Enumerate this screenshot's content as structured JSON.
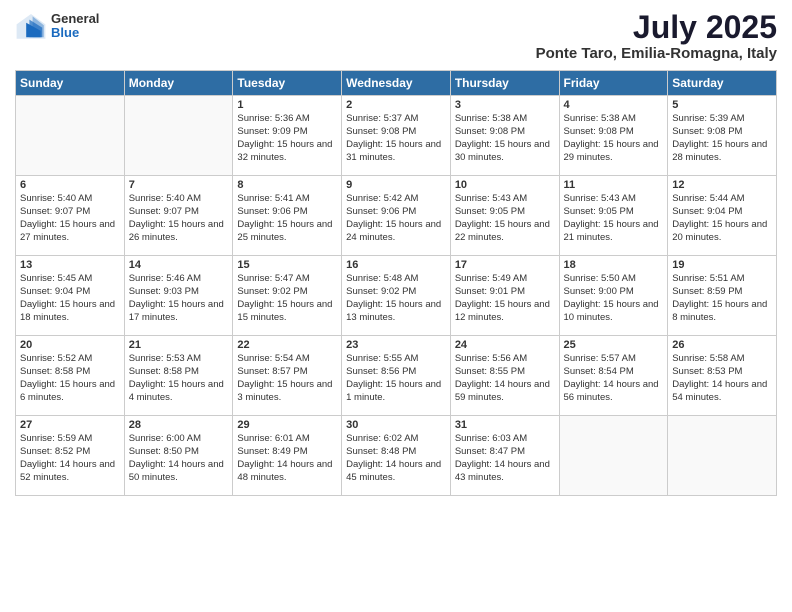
{
  "header": {
    "logo_general": "General",
    "logo_blue": "Blue",
    "title": "July 2025",
    "subtitle": "Ponte Taro, Emilia-Romagna, Italy"
  },
  "days_of_week": [
    "Sunday",
    "Monday",
    "Tuesday",
    "Wednesday",
    "Thursday",
    "Friday",
    "Saturday"
  ],
  "weeks": [
    [
      {
        "day": "",
        "info": ""
      },
      {
        "day": "",
        "info": ""
      },
      {
        "day": "1",
        "info": "Sunrise: 5:36 AM\nSunset: 9:09 PM\nDaylight: 15 hours\nand 32 minutes."
      },
      {
        "day": "2",
        "info": "Sunrise: 5:37 AM\nSunset: 9:08 PM\nDaylight: 15 hours\nand 31 minutes."
      },
      {
        "day": "3",
        "info": "Sunrise: 5:38 AM\nSunset: 9:08 PM\nDaylight: 15 hours\nand 30 minutes."
      },
      {
        "day": "4",
        "info": "Sunrise: 5:38 AM\nSunset: 9:08 PM\nDaylight: 15 hours\nand 29 minutes."
      },
      {
        "day": "5",
        "info": "Sunrise: 5:39 AM\nSunset: 9:08 PM\nDaylight: 15 hours\nand 28 minutes."
      }
    ],
    [
      {
        "day": "6",
        "info": "Sunrise: 5:40 AM\nSunset: 9:07 PM\nDaylight: 15 hours\nand 27 minutes."
      },
      {
        "day": "7",
        "info": "Sunrise: 5:40 AM\nSunset: 9:07 PM\nDaylight: 15 hours\nand 26 minutes."
      },
      {
        "day": "8",
        "info": "Sunrise: 5:41 AM\nSunset: 9:06 PM\nDaylight: 15 hours\nand 25 minutes."
      },
      {
        "day": "9",
        "info": "Sunrise: 5:42 AM\nSunset: 9:06 PM\nDaylight: 15 hours\nand 24 minutes."
      },
      {
        "day": "10",
        "info": "Sunrise: 5:43 AM\nSunset: 9:05 PM\nDaylight: 15 hours\nand 22 minutes."
      },
      {
        "day": "11",
        "info": "Sunrise: 5:43 AM\nSunset: 9:05 PM\nDaylight: 15 hours\nand 21 minutes."
      },
      {
        "day": "12",
        "info": "Sunrise: 5:44 AM\nSunset: 9:04 PM\nDaylight: 15 hours\nand 20 minutes."
      }
    ],
    [
      {
        "day": "13",
        "info": "Sunrise: 5:45 AM\nSunset: 9:04 PM\nDaylight: 15 hours\nand 18 minutes."
      },
      {
        "day": "14",
        "info": "Sunrise: 5:46 AM\nSunset: 9:03 PM\nDaylight: 15 hours\nand 17 minutes."
      },
      {
        "day": "15",
        "info": "Sunrise: 5:47 AM\nSunset: 9:02 PM\nDaylight: 15 hours\nand 15 minutes."
      },
      {
        "day": "16",
        "info": "Sunrise: 5:48 AM\nSunset: 9:02 PM\nDaylight: 15 hours\nand 13 minutes."
      },
      {
        "day": "17",
        "info": "Sunrise: 5:49 AM\nSunset: 9:01 PM\nDaylight: 15 hours\nand 12 minutes."
      },
      {
        "day": "18",
        "info": "Sunrise: 5:50 AM\nSunset: 9:00 PM\nDaylight: 15 hours\nand 10 minutes."
      },
      {
        "day": "19",
        "info": "Sunrise: 5:51 AM\nSunset: 8:59 PM\nDaylight: 15 hours\nand 8 minutes."
      }
    ],
    [
      {
        "day": "20",
        "info": "Sunrise: 5:52 AM\nSunset: 8:58 PM\nDaylight: 15 hours\nand 6 minutes."
      },
      {
        "day": "21",
        "info": "Sunrise: 5:53 AM\nSunset: 8:58 PM\nDaylight: 15 hours\nand 4 minutes."
      },
      {
        "day": "22",
        "info": "Sunrise: 5:54 AM\nSunset: 8:57 PM\nDaylight: 15 hours\nand 3 minutes."
      },
      {
        "day": "23",
        "info": "Sunrise: 5:55 AM\nSunset: 8:56 PM\nDaylight: 15 hours\nand 1 minute."
      },
      {
        "day": "24",
        "info": "Sunrise: 5:56 AM\nSunset: 8:55 PM\nDaylight: 14 hours\nand 59 minutes."
      },
      {
        "day": "25",
        "info": "Sunrise: 5:57 AM\nSunset: 8:54 PM\nDaylight: 14 hours\nand 56 minutes."
      },
      {
        "day": "26",
        "info": "Sunrise: 5:58 AM\nSunset: 8:53 PM\nDaylight: 14 hours\nand 54 minutes."
      }
    ],
    [
      {
        "day": "27",
        "info": "Sunrise: 5:59 AM\nSunset: 8:52 PM\nDaylight: 14 hours\nand 52 minutes."
      },
      {
        "day": "28",
        "info": "Sunrise: 6:00 AM\nSunset: 8:50 PM\nDaylight: 14 hours\nand 50 minutes."
      },
      {
        "day": "29",
        "info": "Sunrise: 6:01 AM\nSunset: 8:49 PM\nDaylight: 14 hours\nand 48 minutes."
      },
      {
        "day": "30",
        "info": "Sunrise: 6:02 AM\nSunset: 8:48 PM\nDaylight: 14 hours\nand 45 minutes."
      },
      {
        "day": "31",
        "info": "Sunrise: 6:03 AM\nSunset: 8:47 PM\nDaylight: 14 hours\nand 43 minutes."
      },
      {
        "day": "",
        "info": ""
      },
      {
        "day": "",
        "info": ""
      }
    ]
  ]
}
